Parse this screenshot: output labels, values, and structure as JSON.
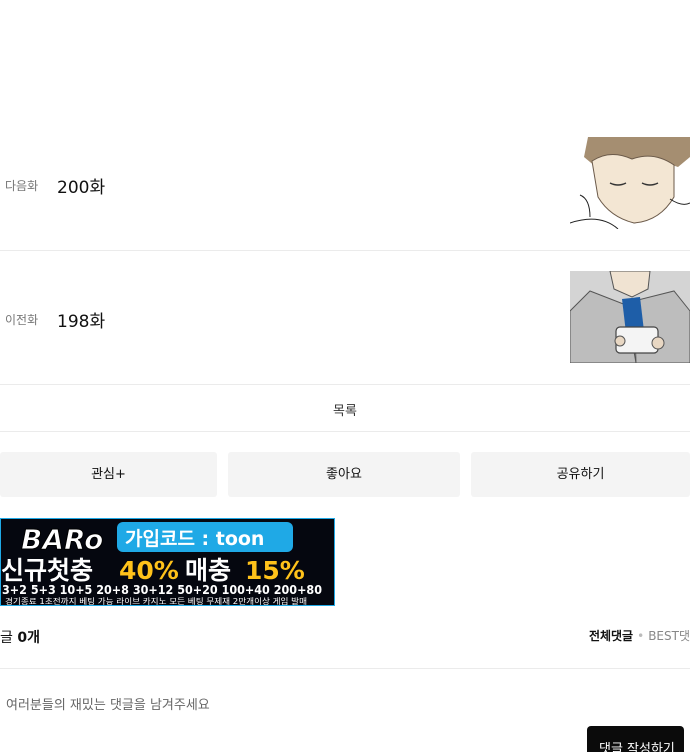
{
  "episodes": {
    "next": {
      "kind": "다음화",
      "title": "200화"
    },
    "prev": {
      "kind": "이전화",
      "title": "198화"
    }
  },
  "list_label": "목록",
  "actions": {
    "subscribe": "관심+",
    "like": "좋아요",
    "share": "공유하기"
  },
  "banner": {
    "logo": "BARo",
    "signup_code": "가입코드 : toon",
    "headline_a": "신규첫충",
    "headline_b": "40%",
    "headline_c": "매충",
    "headline_d": "15%",
    "bonus_line": "3+2 5+3 10+5 20+8 30+12 50+20 100+40 200+80",
    "footer": "경기종료 1초전까지 베팅 가능 라이브 카지노 모든 베팅 무제재 2만개이상 게임 발매"
  },
  "comments": {
    "count_prefix": "글",
    "count_value": "0개",
    "sort_all": "전체댓글",
    "sort_best": "BEST댓",
    "placeholder": "여러분들의 재밌는 댓글을 남겨주세요",
    "write_button": "댓글 작성하기"
  },
  "colors": {
    "button_bg": "#f4f4f4",
    "banner_accent": "#1fa9e6",
    "banner_gold": "#ffc21a",
    "write_button_bg": "#0b0b0b"
  }
}
